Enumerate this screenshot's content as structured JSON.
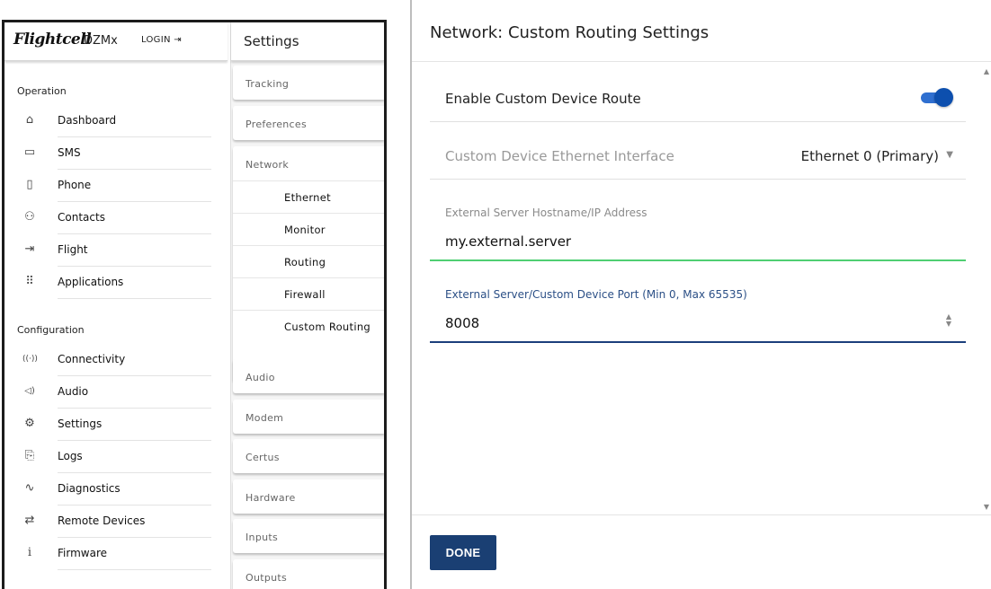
{
  "app": {
    "brand": "Flightcell",
    "device": "DZMx",
    "login_label": "LOGIN ⇥"
  },
  "sidebar": {
    "operation_heading": "Operation",
    "operation_items": [
      {
        "label": "Dashboard",
        "icon": "house-icon",
        "glyph": "⌂"
      },
      {
        "label": "SMS",
        "icon": "chat-bubble-icon",
        "glyph": "▭"
      },
      {
        "label": "Phone",
        "icon": "phone-icon",
        "glyph": "▯"
      },
      {
        "label": "Contacts",
        "icon": "people-icon",
        "glyph": "⚇"
      },
      {
        "label": "Flight",
        "icon": "plane-icon",
        "glyph": "⇥"
      },
      {
        "label": "Applications",
        "icon": "grid-icon",
        "glyph": "⠿"
      }
    ],
    "configuration_heading": "Configuration",
    "configuration_items": [
      {
        "label": "Connectivity",
        "icon": "signal-icon",
        "glyph": "((·))"
      },
      {
        "label": "Audio",
        "icon": "speaker-icon",
        "glyph": "◁)"
      },
      {
        "label": "Settings",
        "icon": "gear-icon",
        "glyph": "⚙"
      },
      {
        "label": "Logs",
        "icon": "documents-icon",
        "glyph": "⎘"
      },
      {
        "label": "Diagnostics",
        "icon": "pulse-icon",
        "glyph": "∿"
      },
      {
        "label": "Remote Devices",
        "icon": "swap-arrows-icon",
        "glyph": "⇄"
      },
      {
        "label": "Firmware",
        "icon": "info-icon",
        "glyph": "i"
      }
    ]
  },
  "settings": {
    "title": "Settings",
    "sections": [
      "Tracking",
      "Preferences",
      "Network",
      "Audio",
      "Modem",
      "Certus",
      "Hardware",
      "Inputs",
      "Outputs"
    ],
    "network_subitems": [
      "Ethernet",
      "Monitor",
      "Routing",
      "Firewall",
      "Custom Routing"
    ]
  },
  "modal": {
    "title": "Network: Custom Routing Settings",
    "enable_label": "Enable Custom Device Route",
    "enable_on": true,
    "interface_label": "Custom Device Ethernet Interface",
    "interface_value": "Ethernet 0 (Primary)",
    "host_label": "External Server Hostname/IP Address",
    "host_value": "my.external.server",
    "port_label": "External Server/Custom Device Port (Min 0, Max 65535)",
    "port_value": "8008",
    "done_label": "DONE",
    "colors": {
      "accent": "#1a3f73",
      "toggle": "#0d4fae",
      "valid_underline": "#4fcf72"
    }
  }
}
